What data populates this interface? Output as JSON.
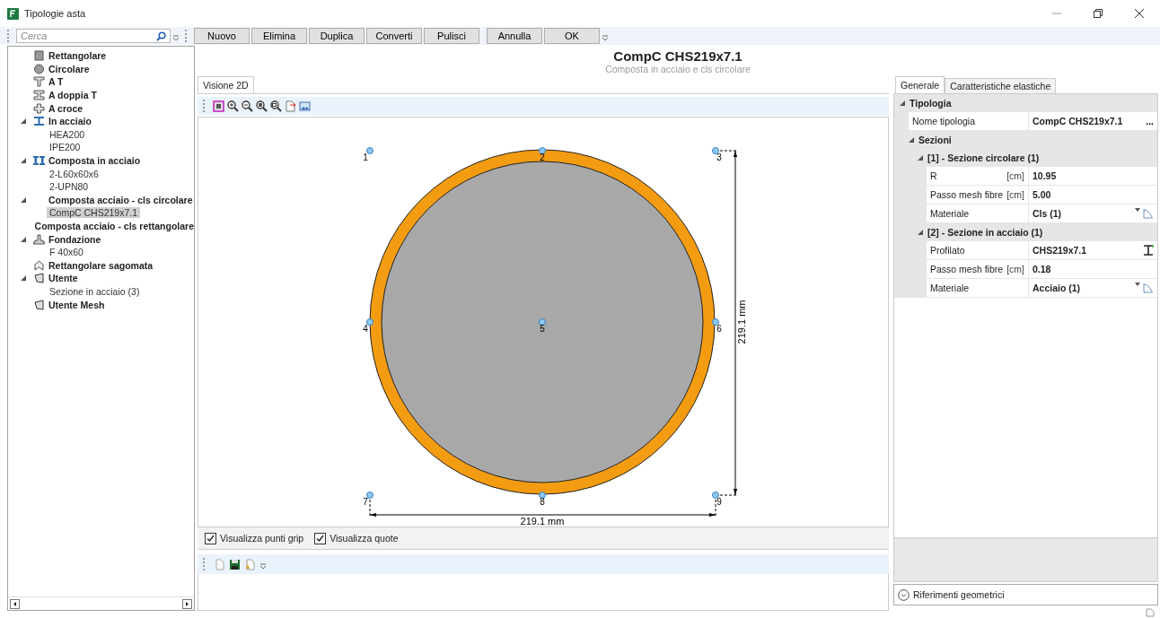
{
  "window": {
    "title": "Tipologie asta"
  },
  "toolbar": {
    "search": {
      "placeholder": "Cerca"
    },
    "buttons": [
      "Nuovo",
      "Elimina",
      "Duplica",
      "Converti",
      "Pulisci",
      "Annulla",
      "OK"
    ]
  },
  "tree": [
    {
      "label": "Rettangolare",
      "kind": "rect"
    },
    {
      "label": "Circolare",
      "kind": "circle"
    },
    {
      "label": "A T",
      "kind": "tee"
    },
    {
      "label": "A doppia T",
      "kind": "double-tee"
    },
    {
      "label": "A croce",
      "kind": "cross"
    },
    {
      "label": "In acciaio",
      "kind": "steel",
      "expanded": true,
      "children": [
        {
          "label": "HEA200",
          "selected": false
        },
        {
          "label": "IPE200",
          "selected": false
        }
      ]
    },
    {
      "label": "Composta in acciaio",
      "kind": "composite",
      "expanded": true,
      "children": [
        {
          "label": "2-L60x60x6",
          "selected": false
        },
        {
          "label": "2-UPN80",
          "selected": false
        }
      ]
    },
    {
      "label": "Composta acciaio - cls circolare",
      "kind": "none",
      "expanded": true,
      "children": [
        {
          "label": "CompC CHS219x7.1",
          "selected": true
        }
      ]
    },
    {
      "label": "Composta acciaio - cls rettangolare",
      "kind": "none"
    },
    {
      "label": "Fondazione",
      "kind": "foundation",
      "expanded": true,
      "children": [
        {
          "label": "F 40x60",
          "selected": false
        }
      ]
    },
    {
      "label": "Rettangolare sagomata",
      "kind": "shaped"
    },
    {
      "label": "Utente",
      "kind": "user",
      "expanded": true,
      "children": [
        {
          "label": "Sezione in acciaio (3)",
          "selected": false
        }
      ]
    },
    {
      "label": "Utente Mesh",
      "kind": "user"
    }
  ],
  "header": {
    "title": "CompC CHS219x7.1",
    "subtitle": "Composta in acciaio e cls circolare"
  },
  "view_tabs": [
    {
      "label": "Visione 2D",
      "selected": true
    }
  ],
  "canvas": {
    "points": [
      "1",
      "2",
      "3",
      "4",
      "5",
      "6",
      "7",
      "8",
      "9"
    ],
    "dimension_vertical": "219.1 mm",
    "dimension_horizontal": "219.1 mm"
  },
  "options": [
    {
      "label": "Visualizza punti grip",
      "checked": true
    },
    {
      "label": "Visualizza quote",
      "checked": true
    }
  ],
  "property_tabs": [
    {
      "label": "Generale",
      "selected": true
    },
    {
      "label": "Caratteristiche elastiche",
      "selected": false
    }
  ],
  "properties": [
    {
      "title": "Tipologia",
      "expanded": true,
      "rows": [
        {
          "label": "Nome tipologia",
          "value": "CompC CHS219x7.1",
          "kind": "ellipsis",
          "button": "..."
        }
      ],
      "children": [
        {
          "title": "Sezioni",
          "expanded": true,
          "children": [
            {
              "title": "[1] - Sezione circolare (1)",
              "expanded": true,
              "rows": [
                {
                  "label": "R",
                  "unit": "[cm]",
                  "value": "10.95",
                  "kind": "text"
                },
                {
                  "label": "Passo mesh fibre",
                  "unit": "[cm]",
                  "value": "5.00",
                  "kind": "text"
                },
                {
                  "label": "Materiale",
                  "value": "Cls (1)",
                  "kind": "material"
                }
              ]
            },
            {
              "title": "[2] - Sezione in acciaio (1)",
              "expanded": true,
              "rows": [
                {
                  "label": "Profilato",
                  "value": "CHS219x7.1",
                  "kind": "profile"
                },
                {
                  "label": "Passo mesh fibre",
                  "unit": "[cm]",
                  "value": "0.18",
                  "kind": "text"
                },
                {
                  "label": "Materiale",
                  "value": "Acciaio (1)",
                  "kind": "material"
                }
              ]
            }
          ]
        }
      ]
    }
  ],
  "footer_panel": {
    "label": "Riferimenti geometrici",
    "expanded": false
  }
}
